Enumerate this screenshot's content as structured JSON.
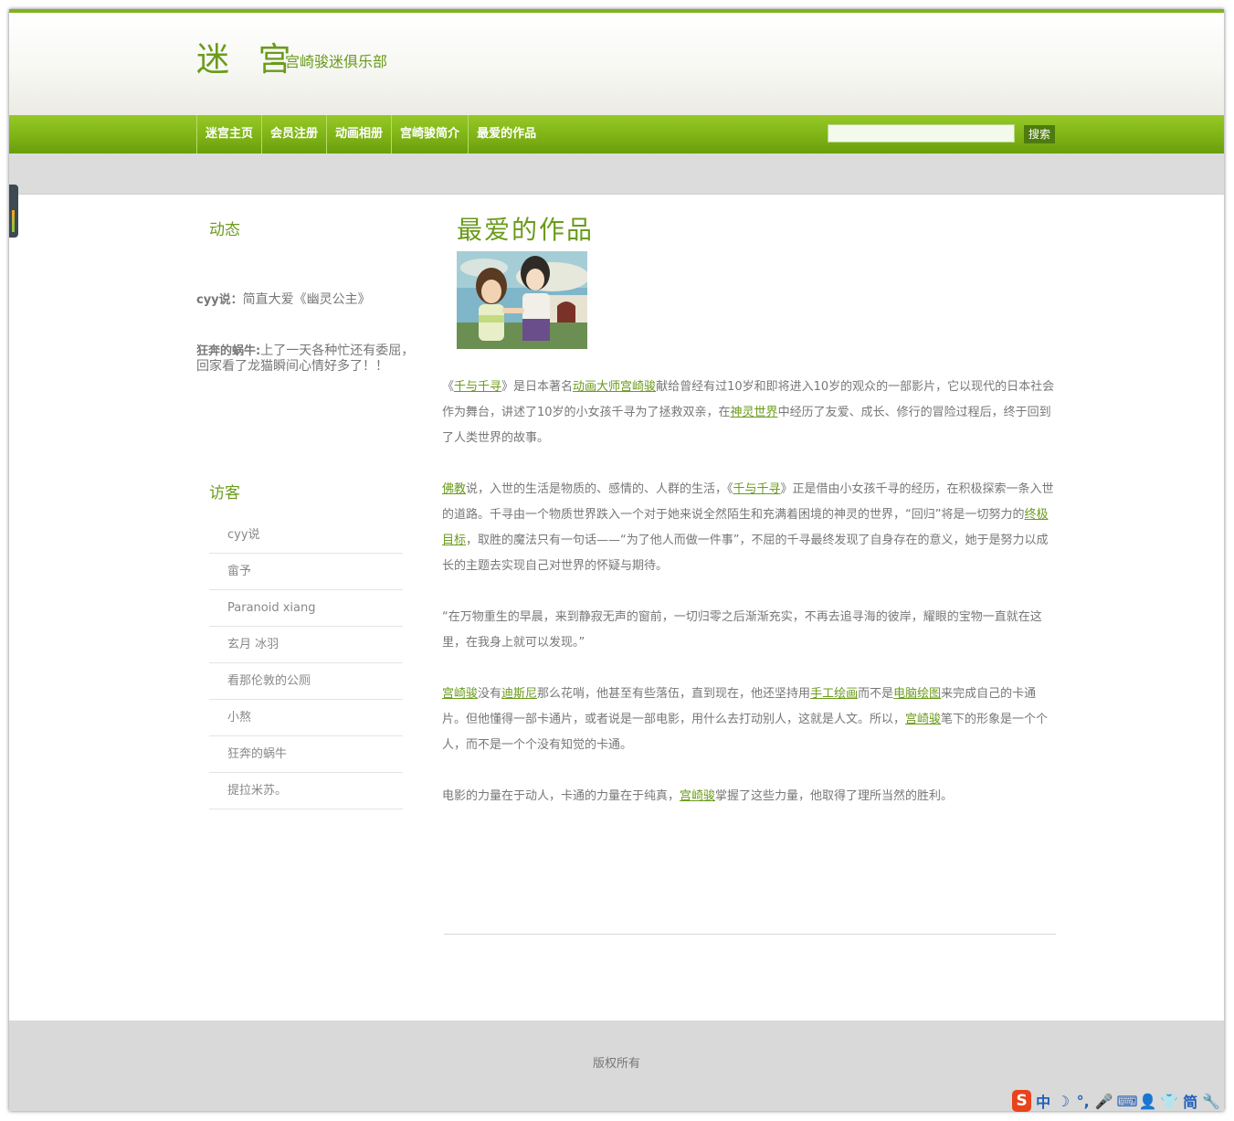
{
  "header": {
    "title": "迷 宫",
    "subtitle": "—宫崎骏迷俱乐部"
  },
  "nav": {
    "items": [
      "迷宫主页",
      "会员注册",
      "动画相册",
      "宫崎骏简介",
      "最爱的作品"
    ],
    "search_placeholder": "",
    "search_button": "搜索"
  },
  "sidebar": {
    "updates_title": "动态",
    "updates": [
      {
        "user": "cyy说",
        "sep": "：",
        "text": "简直大爱《幽灵公主》"
      },
      {
        "user": "狂奔的蜗牛",
        "sep": ":",
        "text": "上了一天各种忙还有委屈，回家看了龙猫瞬间心情好多了！！"
      }
    ],
    "visitors_title": "访客",
    "visitors": [
      "cyy说",
      "畲予",
      "Paranoid xiang",
      "玄月 冰羽",
      "看那伦敦的公厕",
      "小熬",
      "狂奔的蜗牛",
      "提拉米苏。"
    ]
  },
  "main": {
    "title": "最爱的作品",
    "poster_alt": "千与千寻",
    "p1": {
      "t1": "《",
      "l1": "千与千寻",
      "t2": "》是日本著名",
      "l2": "动画大师宫崎骏",
      "t3": "献给曾经有过10岁和即将进入10岁的观众的一部影片，它以现代的日本社会作为舞台，讲述了10岁的小女孩千寻为了拯救双亲，在",
      "l3": "神灵世界",
      "t4": "中经历了友爱、成长、修行的冒险过程后，终于回到了人类世界的故事。"
    },
    "p2": {
      "l1": "佛教",
      "t1": "说，入世的生活是物质的、感情的、人群的生活，《",
      "l2": "千与千寻",
      "t2": "》正是借由小女孩千寻的经历，在积极探索一条入世的道路。千寻由一个物质世界跌入一个对于她来说全然陌生和充满着困境的神灵的世界，“回归”将是一切努力的",
      "l3": "终极目标",
      "t3": "，取胜的魔法只有一句话——“为了他人而做一件事”，不屈的千寻最终发现了自身存在的意义，她于是努力以成长的主题去实现自己对世界的怀疑与期待。"
    },
    "p3": {
      "t1": "“在万物重生的早晨，来到静寂无声的窗前，一切归零之后渐渐充实，不再去追寻海的彼岸，耀眼的宝物一直就在这里，在我身上就可以发现。”"
    },
    "p4": {
      "l1": "宫崎骏",
      "t1": "没有",
      "l2": "迪斯尼",
      "t2": "那么花哨，他甚至有些落伍，直到现在，他还坚持用",
      "l3": "手工绘画",
      "t3": "而不是",
      "l4": "电脑绘图",
      "t4": "来完成自己的卡通片。但他懂得一部卡通片，或者说是一部电影，用什么去打动别人，这就是人文。所以，",
      "l5": "宫崎骏",
      "t5": "笔下的形象是一个个人，而不是一个个没有知觉的卡通。"
    },
    "p5": {
      "t1": "电影的力量在于动人，卡通的力量在于纯真，",
      "l1": "宫崎骏",
      "t2": "掌握了这些力量，他取得了理所当然的胜利。"
    }
  },
  "footer": {
    "copyright": "版权所有"
  },
  "ime": {
    "logo": "S",
    "items": [
      "中",
      "☽",
      "°,",
      "🎤",
      "⌨",
      "👤",
      "👕",
      "简",
      "🔧"
    ]
  },
  "colors": {
    "accent": "#6a9b1b",
    "nav_green": "#7fb416",
    "link": "#6a9b1b",
    "text": "#777777"
  }
}
